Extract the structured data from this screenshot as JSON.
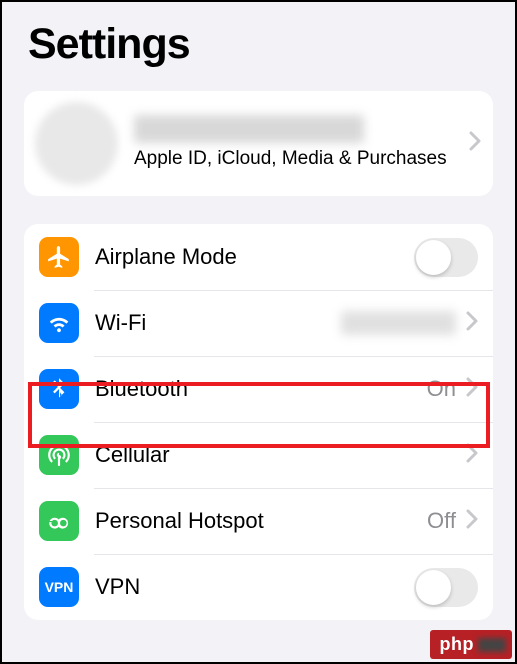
{
  "title": "Settings",
  "apple_id": {
    "subtitle": "Apple ID, iCloud, Media & Purchases"
  },
  "rows": {
    "airplane": {
      "label": "Airplane Mode"
    },
    "wifi": {
      "label": "Wi-Fi"
    },
    "bluetooth": {
      "label": "Bluetooth",
      "value": "On"
    },
    "cellular": {
      "label": "Cellular"
    },
    "hotspot": {
      "label": "Personal Hotspot",
      "value": "Off"
    },
    "vpn": {
      "label": "VPN",
      "icon_text": "VPN"
    }
  },
  "watermark": "php"
}
